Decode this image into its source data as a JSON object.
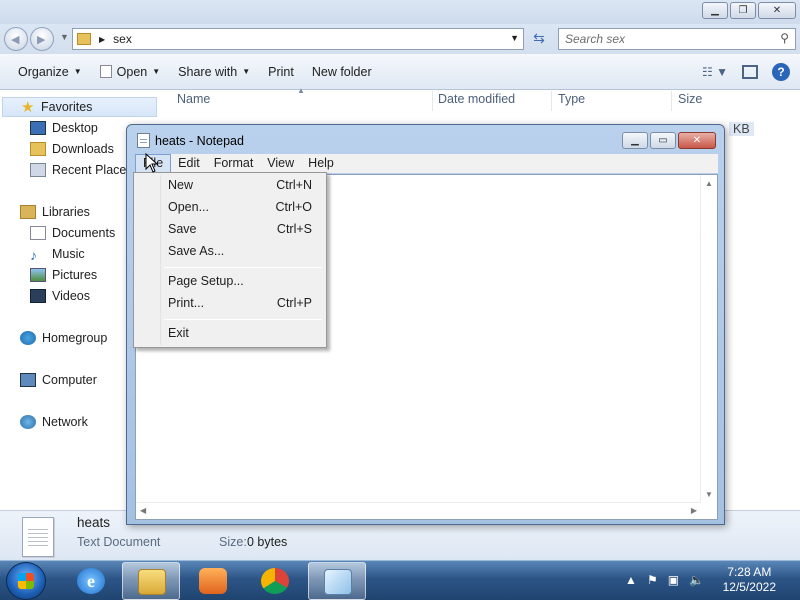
{
  "explorer": {
    "address_path": "sex",
    "search_placeholder": "Search sex",
    "toolbar": {
      "organize": "Organize",
      "open": "Open",
      "share_with": "Share with",
      "print": "Print",
      "new_folder": "New folder"
    },
    "columns": {
      "name": "Name",
      "date_modified": "Date modified",
      "type": "Type",
      "size": "Size",
      "partial_size": "KB"
    },
    "nav": {
      "favorites": "Favorites",
      "desktop": "Desktop",
      "downloads": "Downloads",
      "recent_places": "Recent Places",
      "libraries": "Libraries",
      "documents": "Documents",
      "music": "Music",
      "pictures": "Pictures",
      "videos": "Videos",
      "homegroup": "Homegroup",
      "computer": "Computer",
      "network": "Network"
    },
    "details": {
      "file_name": "heats",
      "file_type": "Text Document",
      "size_label": "Size:",
      "size_value": "0 bytes"
    }
  },
  "notepad": {
    "title": "heats - Notepad",
    "menus": {
      "file": "File",
      "edit": "Edit",
      "format": "Format",
      "view": "View",
      "help": "Help"
    },
    "file_menu": [
      {
        "label": "New",
        "shortcut": "Ctrl+N"
      },
      {
        "label": "Open...",
        "shortcut": "Ctrl+O"
      },
      {
        "label": "Save",
        "shortcut": "Ctrl+S"
      },
      {
        "label": "Save As...",
        "shortcut": ""
      },
      {
        "label": "Page Setup...",
        "shortcut": ""
      },
      {
        "label": "Print...",
        "shortcut": "Ctrl+P"
      },
      {
        "label": "Exit",
        "shortcut": ""
      }
    ],
    "text_content": ""
  },
  "taskbar": {
    "time": "7:28 AM",
    "date": "12/5/2022"
  },
  "colors": {
    "taskbar_top": "#5a87b8",
    "taskbar_bottom": "#1f4470",
    "window_frame": "#b9d1ec",
    "close_button": "#c9574a"
  },
  "icons": [
    "back-icon",
    "forward-icon",
    "folder-icon",
    "refresh-icon",
    "search-icon",
    "help-icon",
    "star-icon",
    "start-orb-icon",
    "ie-icon",
    "explorer-icon",
    "media-player-icon",
    "chrome-icon",
    "notepad-icon",
    "flag-icon",
    "network-icon",
    "speaker-icon"
  ]
}
